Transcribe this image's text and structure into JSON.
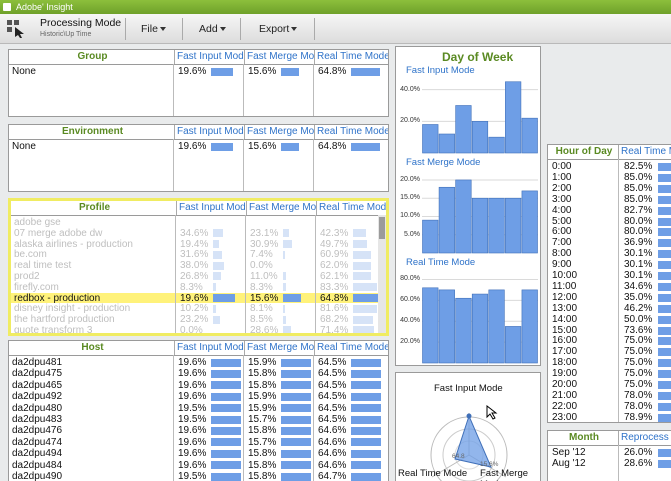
{
  "app": {
    "title": "Adobe' Insight"
  },
  "toolbar": {
    "mode": "Processing Mode",
    "sub": "Historic\\Up Time",
    "menus": [
      "File",
      "Add",
      "Export"
    ]
  },
  "col_headers": [
    "Fast Input Mode",
    "Fast Merge Mode",
    "Real Time Mode"
  ],
  "group": {
    "title": "Group",
    "rows": [
      {
        "name": "None",
        "v": [
          "19.6%",
          "15.6%",
          "64.8%"
        ],
        "f": [
          0.7,
          0.55,
          0.9
        ]
      }
    ]
  },
  "environment": {
    "title": "Environment",
    "rows": [
      {
        "name": "None",
        "v": [
          "19.6%",
          "15.6%",
          "64.8%"
        ],
        "f": [
          0.7,
          0.55,
          0.9
        ]
      }
    ]
  },
  "profile": {
    "title": "Profile",
    "rows": [
      {
        "name": "adobe gse",
        "v": [
          "",
          "",
          ""
        ],
        "f": [
          0,
          0,
          0
        ]
      },
      {
        "name": "07 merge adobe dw",
        "v": [
          "34.6%",
          "23.1%",
          "42.3%"
        ],
        "f": [
          0.3,
          0.2,
          0.4
        ]
      },
      {
        "name": "alaska airlines - production",
        "v": [
          "19.4%",
          "30.9%",
          "49.7%"
        ],
        "f": [
          0.18,
          0.28,
          0.45
        ]
      },
      {
        "name": "be.com",
        "v": [
          "31.6%",
          "7.4%",
          "60.9%"
        ],
        "f": [
          0.28,
          0.07,
          0.55
        ]
      },
      {
        "name": "real time test",
        "v": [
          "38.0%",
          "0.0%",
          "62.0%"
        ],
        "f": [
          0.34,
          0.0,
          0.56
        ]
      },
      {
        "name": "prod2",
        "v": [
          "26.8%",
          "11.0%",
          "62.1%"
        ],
        "f": [
          0.24,
          0.1,
          0.56
        ]
      },
      {
        "name": "firefly.com",
        "v": [
          "8.3%",
          "8.3%",
          "83.3%"
        ],
        "f": [
          0.08,
          0.08,
          0.75
        ]
      },
      {
        "name": "redbox - production",
        "v": [
          "19.6%",
          "15.6%",
          "64.8%"
        ],
        "f": [
          0.7,
          0.55,
          0.9
        ],
        "selected": true
      },
      {
        "name": "disney insight - production",
        "v": [
          "10.2%",
          "8.1%",
          "81.6%"
        ],
        "f": [
          0.09,
          0.07,
          0.74
        ]
      },
      {
        "name": "the hartford production",
        "v": [
          "23.2%",
          "8.5%",
          "68.2%"
        ],
        "f": [
          0.21,
          0.08,
          0.62
        ]
      },
      {
        "name": "quote transform 3",
        "v": [
          "0.0%",
          "28.6%",
          "71.4%"
        ],
        "f": [
          0.0,
          0.26,
          0.65
        ]
      }
    ]
  },
  "host": {
    "title": "Host",
    "rows": [
      {
        "name": "da2dpu481",
        "v": [
          "19.6%",
          "15.9%",
          "64.5%"
        ]
      },
      {
        "name": "da2dpu475",
        "v": [
          "19.6%",
          "15.8%",
          "64.5%"
        ]
      },
      {
        "name": "da2dpu465",
        "v": [
          "19.6%",
          "15.8%",
          "64.5%"
        ]
      },
      {
        "name": "da2dpu492",
        "v": [
          "19.6%",
          "15.9%",
          "64.5%"
        ]
      },
      {
        "name": "da2dpu480",
        "v": [
          "19.5%",
          "15.9%",
          "64.5%"
        ]
      },
      {
        "name": "da2dpu483",
        "v": [
          "19.5%",
          "15.7%",
          "64.5%"
        ]
      },
      {
        "name": "da2dpu476",
        "v": [
          "19.6%",
          "15.8%",
          "64.6%"
        ]
      },
      {
        "name": "da2dpu474",
        "v": [
          "19.6%",
          "15.7%",
          "64.6%"
        ]
      },
      {
        "name": "da2dpu494",
        "v": [
          "19.6%",
          "15.8%",
          "64.6%"
        ]
      },
      {
        "name": "da2dpu484",
        "v": [
          "19.6%",
          "15.8%",
          "64.6%"
        ]
      },
      {
        "name": "da2dpu490",
        "v": [
          "19.5%",
          "15.8%",
          "64.7%"
        ]
      }
    ]
  },
  "dow": {
    "title": "Day of Week",
    "charts": [
      {
        "name": "Fast Input Mode",
        "ticks": [
          "40.0%",
          "20.0%"
        ],
        "tick_vals": [
          40,
          20
        ],
        "ymax": 48,
        "values": [
          18,
          12,
          30,
          20,
          10,
          45,
          22
        ]
      },
      {
        "name": "Fast Merge Mode",
        "ticks": [
          "20.0%",
          "15.0%",
          "10.0%",
          "5.0%"
        ],
        "tick_vals": [
          20,
          15,
          10,
          5
        ],
        "ymax": 23,
        "values": [
          9,
          18,
          20,
          15,
          15,
          15,
          17
        ]
      },
      {
        "name": "Real Time Mode",
        "ticks": [
          "80.0%",
          "60.0%",
          "40.0%",
          "20.0%"
        ],
        "tick_vals": [
          80,
          60,
          40,
          20
        ],
        "ymax": 90,
        "values": [
          72,
          70,
          62,
          66,
          70,
          35,
          70
        ]
      }
    ]
  },
  "radar": {
    "title": "Fast Input Mode",
    "labels": [
      "Real Time Mode",
      "Fast Merge Mode"
    ],
    "inner": [
      "64.8",
      "15.6%"
    ]
  },
  "hour": {
    "title": "Hour of Day",
    "col": "Real Time M",
    "rows": [
      [
        "0:00",
        "82.5%"
      ],
      [
        "1:00",
        "85.0%"
      ],
      [
        "2:00",
        "85.0%"
      ],
      [
        "3:00",
        "85.0%"
      ],
      [
        "4:00",
        "82.7%"
      ],
      [
        "5:00",
        "80.0%"
      ],
      [
        "6:00",
        "80.0%"
      ],
      [
        "7:00",
        "36.9%"
      ],
      [
        "8:00",
        "30.1%"
      ],
      [
        "9:00",
        "30.1%"
      ],
      [
        "10:00",
        "30.1%"
      ],
      [
        "11:00",
        "34.6%"
      ],
      [
        "12:00",
        "35.0%"
      ],
      [
        "13:00",
        "46.2%"
      ],
      [
        "14:00",
        "50.0%"
      ],
      [
        "15:00",
        "73.6%"
      ],
      [
        "16:00",
        "75.0%"
      ],
      [
        "17:00",
        "75.0%"
      ],
      [
        "18:00",
        "75.0%"
      ],
      [
        "19:00",
        "75.0%"
      ],
      [
        "20:00",
        "75.0%"
      ],
      [
        "21:00",
        "78.0%"
      ],
      [
        "22:00",
        "78.0%"
      ],
      [
        "23:00",
        "78.9%"
      ]
    ]
  },
  "month": {
    "title": "Month",
    "col": "Reprocess",
    "rows": [
      [
        "Sep '12",
        "26.0%"
      ],
      [
        "Aug '12",
        "28.6%"
      ]
    ]
  },
  "colors": {
    "accent": "#6e9ee6",
    "header_green": "#5a8a22",
    "header_blue": "#2f73c9",
    "selection": "#fff27a"
  }
}
